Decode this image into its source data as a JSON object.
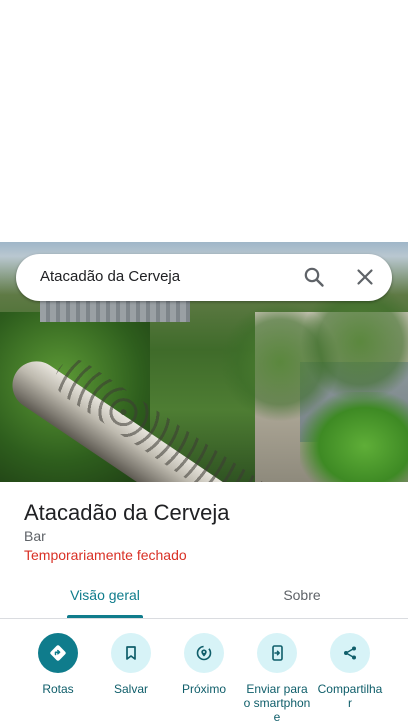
{
  "search": {
    "query": "Atacadão da Cerveja",
    "search_icon": "search-icon",
    "close_icon": "close-icon"
  },
  "place": {
    "name": "Atacadão da Cerveja",
    "category": "Bar",
    "status": "Temporariamente fechado",
    "status_color": "#d93025"
  },
  "tabs": [
    {
      "label": "Visão geral",
      "selected": true
    },
    {
      "label": "Sobre",
      "selected": false
    }
  ],
  "actions": [
    {
      "label": "Rotas",
      "icon": "directions-icon"
    },
    {
      "label": "Salvar",
      "icon": "bookmark-icon"
    },
    {
      "label": "Próximo",
      "icon": "nearby-icon"
    },
    {
      "label": "Enviar para o smartphone",
      "icon": "send-to-phone-icon"
    },
    {
      "label": "Compartilhar",
      "icon": "share-icon"
    }
  ],
  "colors": {
    "accent": "#0f7c8c",
    "action_bg": "#d7f3f7"
  }
}
